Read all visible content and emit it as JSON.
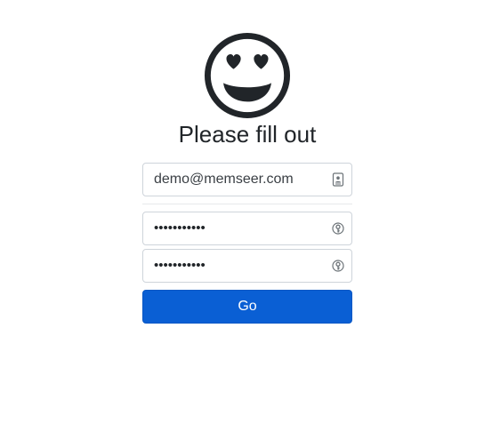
{
  "header": {
    "emoji_icon": "smiling-face-with-heart-eyes-icon",
    "title": "Please fill out"
  },
  "form": {
    "email": {
      "value": "demo@memseer.com",
      "icon": "contact-card-icon"
    },
    "password": {
      "value": "•••••••••••",
      "icon": "key-autofill-icon"
    },
    "password_confirm": {
      "value": "•••••••••••",
      "icon": "key-autofill-icon"
    },
    "submit_label": "Go"
  },
  "colors": {
    "accent": "#0a5fd4",
    "text": "#212529",
    "border": "#ced4da"
  }
}
